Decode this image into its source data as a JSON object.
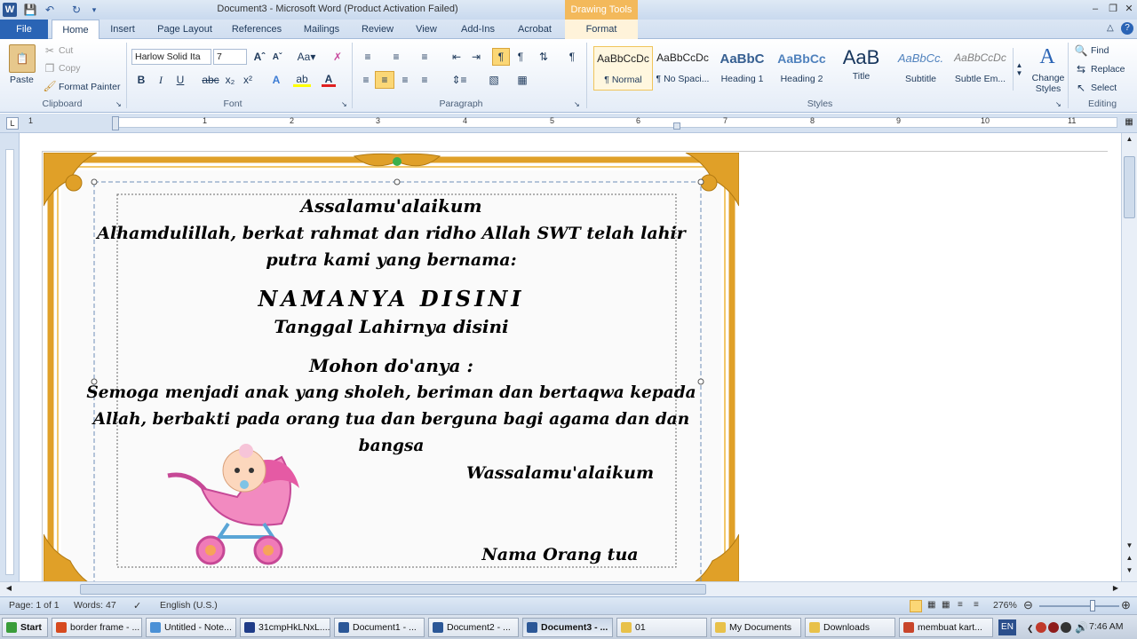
{
  "titlebar": {
    "doc_title": "Document3 - Microsoft Word (Product Activation Failed)",
    "drawing_tools": "Drawing Tools",
    "min": "–",
    "restore": "❐",
    "close": "✕"
  },
  "tabs": [
    "File",
    "Home",
    "Insert",
    "Page Layout",
    "References",
    "Mailings",
    "Review",
    "View",
    "Add-Ins",
    "Acrobat",
    "Format"
  ],
  "clipboard": {
    "paste": "Paste",
    "cut": "Cut",
    "copy": "Copy",
    "format_painter": "Format Painter",
    "label": "Clipboard"
  },
  "font": {
    "family": "Harlow Solid Ita",
    "size": "7",
    "label": "Font"
  },
  "paragraph": {
    "label": "Paragraph"
  },
  "styles": {
    "label": "Styles",
    "items": [
      {
        "preview": "AaBbCcDc",
        "name": "¶ Normal"
      },
      {
        "preview": "AaBbCcDc",
        "name": "¶ No Spaci..."
      },
      {
        "preview": "AaBbC",
        "name": "Heading 1"
      },
      {
        "preview": "AaBbCc",
        "name": "Heading 2"
      },
      {
        "preview": "AaB",
        "name": "Title"
      },
      {
        "preview": "AaBbCc.",
        "name": "Subtitle"
      },
      {
        "preview": "AaBbCcDc",
        "name": "Subtle Em..."
      }
    ],
    "change_styles": "Change Styles"
  },
  "editing": {
    "find": "Find",
    "replace": "Replace",
    "select": "Select",
    "label": "Editing"
  },
  "ruler": {
    "numbers": [
      "1",
      "1",
      "2",
      "3",
      "4",
      "5",
      "6",
      "7",
      "8",
      "9",
      "10",
      "11"
    ]
  },
  "document": {
    "greeting": "Assalamu'alaikum",
    "line1": "Alhamdulillah, berkat rahmat dan ridho Allah SWT telah lahir",
    "line2": "putra kami yang bernama:",
    "name": "NAMANYA DISINI",
    "birthdate": "Tanggal Lahirnya disini",
    "prayer_title": "Mohon do'anya :",
    "prayer1": "Semoga menjadi anak yang sholeh, beriman dan bertaqwa kepada",
    "prayer2": "Allah, berbakti pada orang tua dan berguna bagi agama dan dan",
    "prayer3": "bangsa",
    "closing": "Wassalamu'alaikum",
    "parents": "Nama Orang tua"
  },
  "status": {
    "page": "Page: 1 of 1",
    "words": "Words: 47",
    "language": "English (U.S.)",
    "zoom": "276%"
  },
  "taskbar": {
    "start": "Start",
    "items": [
      {
        "label": "border frame - ...",
        "color": "#d64a1f"
      },
      {
        "label": "Untitled - Note...",
        "color": "#4a90d6"
      },
      {
        "label": "31cmpHkLNxL....",
        "color": "#1f3c88"
      },
      {
        "label": "Document1 - ...",
        "color": "#2b5797"
      },
      {
        "label": "Document2 - ...",
        "color": "#2b5797"
      },
      {
        "label": "Document3 - ...",
        "color": "#2b5797"
      },
      {
        "label": "01",
        "color": "#e8c14a"
      },
      {
        "label": "My Documents",
        "color": "#e8c14a"
      },
      {
        "label": "Downloads",
        "color": "#e8c14a"
      },
      {
        "label": "membuat kart...",
        "color": "#c8452b"
      }
    ],
    "lang": "EN",
    "clock": "7:46 AM"
  },
  "colors": {
    "accent": "#2b579a",
    "frame_gold": "#e0a028",
    "drawing_tools": "#f3b95b"
  }
}
